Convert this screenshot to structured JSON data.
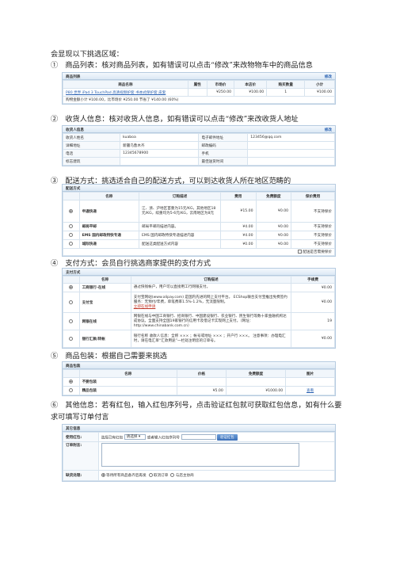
{
  "intro": "会显现以下挑选区域：",
  "captions": {
    "s1": "①　商品列表：核对商品列表，如有错误可以点击“修改”来改物物车中的商品信息",
    "s2": "②　收货人信息：核对收货人信息，如有错误可以点击“修改”来改收货人地址",
    "s3": "③　配送方式：挑选适合自己的配送方式，可以到达收货人所在地区范畴的",
    "s4": "④　支付方式：会员自行挑选商家提供的支付方式",
    "s5": "⑤　商品包装：根据自己需要来挑选",
    "s6": "⑥　其他信息：若有红包，输入红包序列号，点击验证红包就可获取红包信息，如有什么要求可填写订单付言"
  },
  "goods": {
    "title": "商品列表",
    "edit": "修改",
    "headers": [
      "商品名称",
      "属性",
      "市场价",
      "本店价",
      "购买数量",
      "小计"
    ],
    "rows": [
      {
        "name": "P80 世界 iPad 3 TouchPad 高清视频护套 书本式保护套 皮套",
        "attr": "",
        "market": "¥250.00",
        "price": "¥100.00",
        "qty": "1",
        "subtotal": "¥100.00"
      }
    ],
    "summary": "购物金额小计 ¥100.00，比市场价 ¥250.00 节省了 ¥140.00 (60%)"
  },
  "consignee": {
    "title": "收货人信息",
    "edit": "修改",
    "rows": [
      {
        "l1": "收货人姓名",
        "v1": "kuaboa",
        "l2": "电子邮件地址",
        "v2": "123456@qq.com"
      },
      {
        "l1": "详细地址",
        "v1": "新疆乌鲁木齐",
        "l2": "邮政编码",
        "v2": ""
      },
      {
        "l1": "电话",
        "v1": "12345678900",
        "l2": "手机",
        "v2": ""
      },
      {
        "l1": "标志建筑",
        "v1": "",
        "l2": "最佳送货时间",
        "v2": ""
      }
    ]
  },
  "shipping": {
    "title": "配送方式",
    "headers": [
      "名称",
      "订购描述",
      "费用",
      "免费额度",
      "保价费用"
    ],
    "rows": [
      {
        "selected": true,
        "name": "申通快递",
        "desc": "江、浙、沪地区首重为15元/KG，其他地区18元/KG，续重均为5-6元/KG，云南地区为8元",
        "fee": "¥15.00",
        "free": "¥0.00",
        "insure": "不支持保价"
      },
      {
        "selected": false,
        "name": "邮局平邮",
        "desc": "邮局平邮的描述内容。",
        "fee": "¥4.00",
        "free": "¥0.00",
        "insure": "不支持保价"
      },
      {
        "selected": false,
        "name": "EMS 国内邮政特快专递",
        "desc": "EMS 国内邮政特快专递描述内容",
        "fee": "¥4.00",
        "free": "¥0.00",
        "insure": "不支持保价"
      },
      {
        "selected": false,
        "name": "城际快递",
        "desc": "配送这类配送方式内容",
        "fee": "¥0.00",
        "free": "¥0.00",
        "insure": "不支持保价"
      }
    ],
    "insure_note": "配送是否需要保价"
  },
  "payment": {
    "title": "支付方式",
    "headers": [
      "名称",
      "订购描述",
      "手续费"
    ],
    "rows": [
      {
        "selected": true,
        "name": "工商银行-在线",
        "desc": "通过快钱帐户，用户可以直接用工行网银支付。",
        "fee": "¥0.00",
        "link": ""
      },
      {
        "selected": false,
        "name": "支付宝",
        "desc": "支付宝网站(www.alipay.com) 是国内先进的网上支付平台。 ECShop联合支付宝推出免费签约服务：无预付/年费，单笔费率1.5%-1.2%，无流量限制。",
        "fee": "¥0.00",
        "link": "立即在线申请"
      },
      {
        "selected": false,
        "name": "网银在线",
        "desc": "网银在线与中国工商银行、招商银行、中国建设银行、农业银行、民生银行等数十家金融机构达成协议。全面支持全国19家银行的信用卡及借记卡实现网上支付。（网址：http://www.chinabank.com.cn）",
        "fee": "19",
        "link": ""
      },
      {
        "selected": false,
        "name": "银行汇款/转帐",
        "desc": "银行名称 收款人信息：全称 ××× ；帐号或地址 ××× ；开户行 ×××。 注意事项：办理电汇时，请在电汇单“汇款用途”一栏处注明您的订单号。",
        "fee": "¥0.00",
        "link": ""
      }
    ]
  },
  "packing": {
    "title": "商品包装",
    "headers": [
      "名称",
      "价格",
      "免费额度",
      "图片"
    ],
    "rows": [
      {
        "selected": true,
        "name": "不要包装",
        "price": "",
        "free": "",
        "img": ""
      },
      {
        "selected": false,
        "name": "精品包装",
        "price": "¥5.00",
        "free": "¥1000.00",
        "img": "查看"
      }
    ]
  },
  "other": {
    "title": "其它信息",
    "bonus_label": "使用红包:",
    "bonus_select_prefix": "选择已有红包",
    "bonus_select_value": "请选择",
    "bonus_input_hint": "或者输入红包序列号",
    "bonus_button": "验证红包",
    "postscript_label": "订单附言:",
    "shortage_label": "缺货处理:",
    "shortage_options": [
      {
        "selected": true,
        "label": "等待所有商品备齐后再发"
      },
      {
        "selected": false,
        "label": "取消订单"
      },
      {
        "selected": false,
        "label": "与店主协商"
      }
    ]
  }
}
